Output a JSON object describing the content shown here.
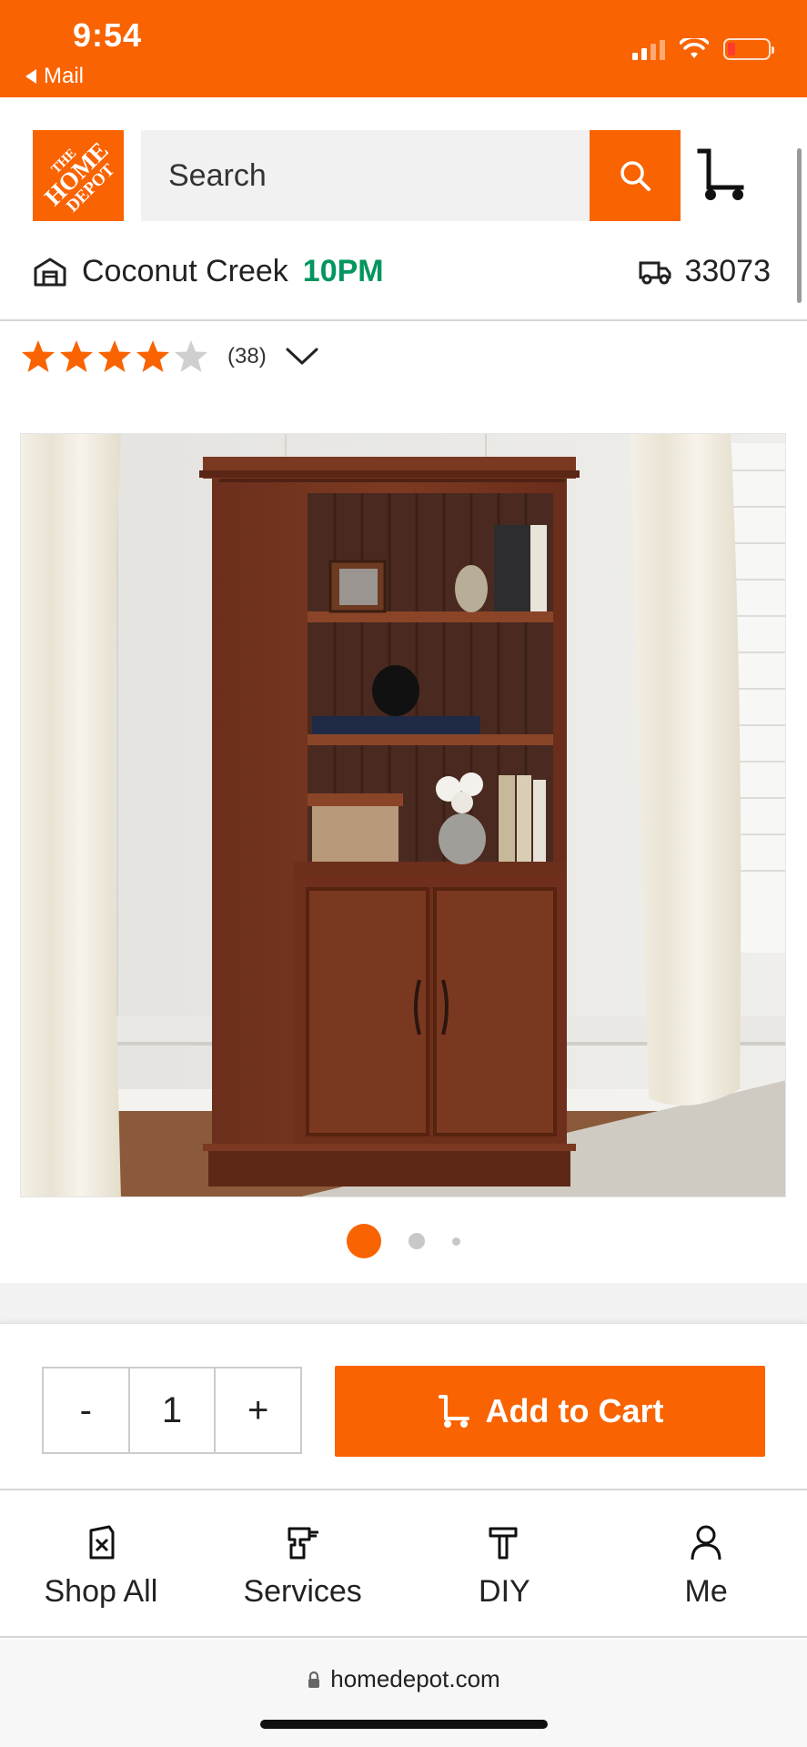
{
  "status_bar": {
    "time": "9:54",
    "back_app": "Mail",
    "battery_color": "#ff3b30"
  },
  "brand": {
    "logo_lines": [
      "THE",
      "HOME",
      "DEPOT"
    ],
    "accent": "#f96302",
    "store_hours_color": "#00965e"
  },
  "header": {
    "search_placeholder": "Search",
    "store_name": "Coconut Creek",
    "store_hours": "10PM",
    "zip": "33073",
    "icons": [
      "store-icon",
      "search-icon",
      "cart-icon",
      "delivery-truck-icon"
    ]
  },
  "rating": {
    "stars_filled": 4,
    "stars_total": 5,
    "review_count": "(38)"
  },
  "product_image": {
    "alt": "Bookcase with cabinet doors",
    "current_index": 1,
    "total_images": 3
  },
  "purchase": {
    "minus_label": "-",
    "quantity": "1",
    "plus_label": "+",
    "add_to_cart_label": "Add to Cart"
  },
  "bottom_nav": {
    "items": [
      {
        "label": "Shop All",
        "icon": "shop-all-icon"
      },
      {
        "label": "Services",
        "icon": "services-drill-icon"
      },
      {
        "label": "DIY",
        "icon": "diy-hammer-icon"
      },
      {
        "label": "Me",
        "icon": "me-person-icon"
      }
    ]
  },
  "browser": {
    "url": "homedepot.com"
  }
}
